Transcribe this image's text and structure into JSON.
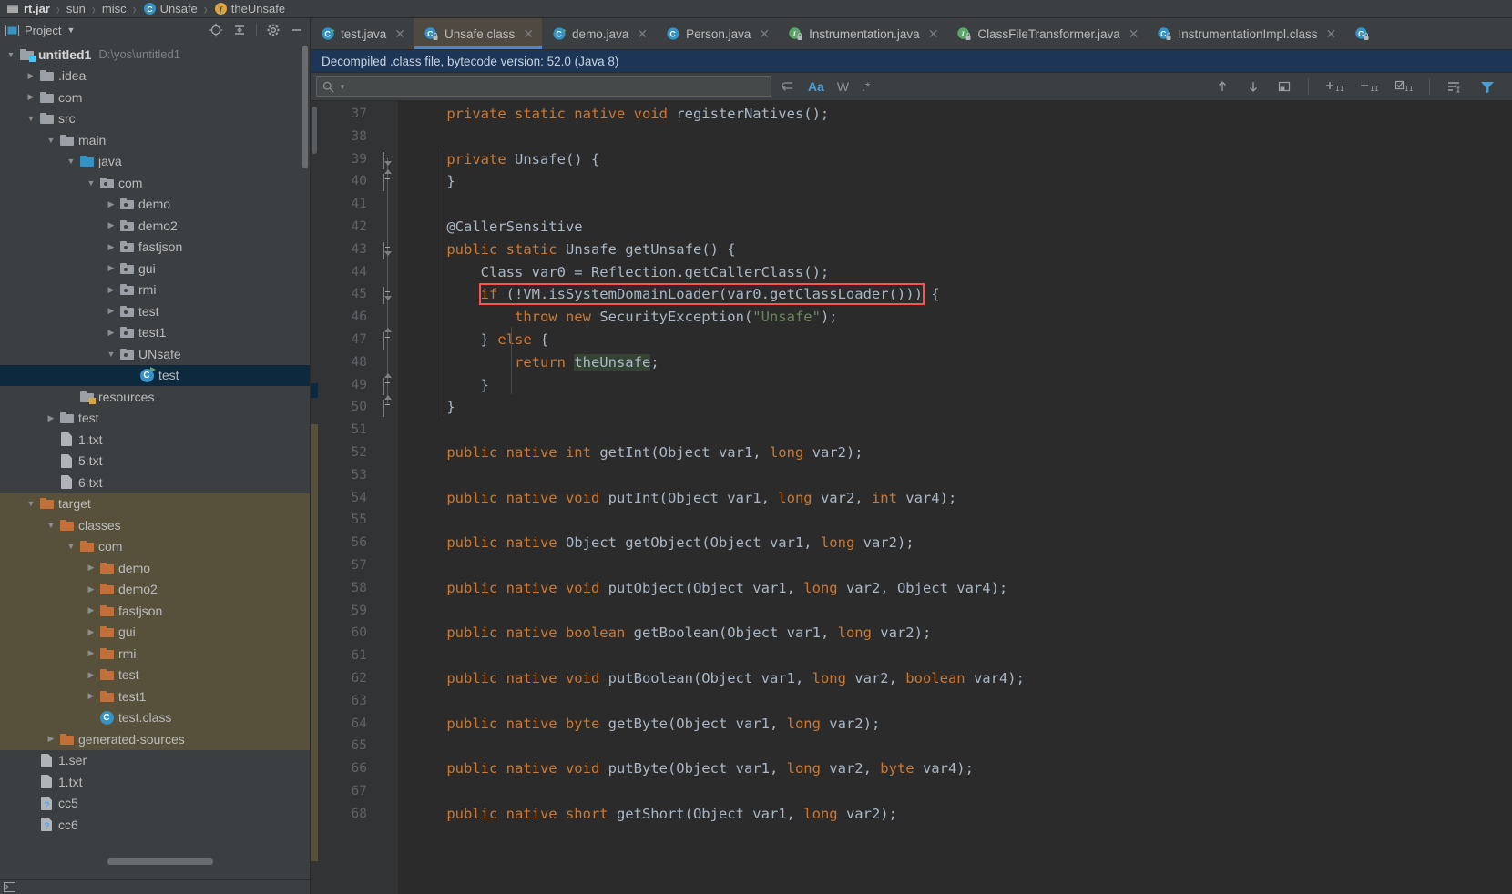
{
  "breadcrumb": [
    {
      "label": "rt.jar",
      "icon": "jar-icon",
      "bold": true
    },
    {
      "label": "sun",
      "icon": "",
      "bold": false
    },
    {
      "label": "misc",
      "icon": "",
      "bold": false
    },
    {
      "label": "Unsafe",
      "icon": "class-icon",
      "bold": false
    },
    {
      "label": "theUnsafe",
      "icon": "field-icon",
      "bold": false
    }
  ],
  "project_panel": {
    "title": "Project",
    "dropdown_glyph": "▼",
    "actions": [
      {
        "name": "locate-icon",
        "glyph": "⊕"
      },
      {
        "name": "collapse-all-icon",
        "glyph": "⌶"
      },
      {
        "name": "settings-gear-icon",
        "glyph": "✿"
      },
      {
        "name": "hide-icon",
        "glyph": "—"
      }
    ],
    "tree": [
      {
        "depth": 0,
        "twisty": "▼",
        "icon": "module-folder-icon",
        "label": "untitled1",
        "bold": true,
        "sub": "D:\\yos\\untitled1",
        "state": "normal"
      },
      {
        "depth": 1,
        "twisty": "▶",
        "icon": "folder-icon",
        "label": ".idea",
        "state": "normal"
      },
      {
        "depth": 1,
        "twisty": "▶",
        "icon": "folder-icon",
        "label": "com",
        "state": "normal"
      },
      {
        "depth": 1,
        "twisty": "▼",
        "icon": "folder-icon",
        "label": "src",
        "state": "normal"
      },
      {
        "depth": 2,
        "twisty": "▼",
        "icon": "folder-icon",
        "label": "main",
        "state": "normal"
      },
      {
        "depth": 3,
        "twisty": "▼",
        "icon": "source-folder-icon",
        "label": "java",
        "state": "normal"
      },
      {
        "depth": 4,
        "twisty": "▼",
        "icon": "package-icon",
        "label": "com",
        "state": "normal"
      },
      {
        "depth": 5,
        "twisty": "▶",
        "icon": "package-icon",
        "label": "demo",
        "state": "normal"
      },
      {
        "depth": 5,
        "twisty": "▶",
        "icon": "package-icon",
        "label": "demo2",
        "state": "normal"
      },
      {
        "depth": 5,
        "twisty": "▶",
        "icon": "package-icon",
        "label": "fastjson",
        "state": "normal"
      },
      {
        "depth": 5,
        "twisty": "▶",
        "icon": "package-icon",
        "label": "gui",
        "state": "normal"
      },
      {
        "depth": 5,
        "twisty": "▶",
        "icon": "package-icon",
        "label": "rmi",
        "state": "normal"
      },
      {
        "depth": 5,
        "twisty": "▶",
        "icon": "package-icon",
        "label": "test",
        "state": "normal"
      },
      {
        "depth": 5,
        "twisty": "▶",
        "icon": "package-icon",
        "label": "test1",
        "state": "normal"
      },
      {
        "depth": 5,
        "twisty": "▼",
        "icon": "package-icon",
        "label": "UNsafe",
        "state": "normal"
      },
      {
        "depth": 6,
        "twisty": "",
        "icon": "java-class-icon",
        "label": "test",
        "state": "selected"
      },
      {
        "depth": 3,
        "twisty": "",
        "icon": "resources-folder-icon",
        "label": "resources",
        "state": "normal"
      },
      {
        "depth": 2,
        "twisty": "▶",
        "icon": "folder-icon",
        "label": "test",
        "state": "normal"
      },
      {
        "depth": 2,
        "twisty": "",
        "icon": "text-file-icon",
        "label": "1.txt",
        "state": "normal"
      },
      {
        "depth": 2,
        "twisty": "",
        "icon": "text-file-icon",
        "label": "5.txt",
        "state": "normal"
      },
      {
        "depth": 2,
        "twisty": "",
        "icon": "text-file-icon",
        "label": "6.txt",
        "state": "normal"
      },
      {
        "depth": 1,
        "twisty": "▼",
        "icon": "excluded-folder-icon",
        "label": "target",
        "state": "excluded"
      },
      {
        "depth": 2,
        "twisty": "▼",
        "icon": "excluded-folder-icon",
        "label": "classes",
        "state": "excluded"
      },
      {
        "depth": 3,
        "twisty": "▼",
        "icon": "excluded-folder-icon",
        "label": "com",
        "state": "excluded"
      },
      {
        "depth": 4,
        "twisty": "▶",
        "icon": "excluded-folder-icon",
        "label": "demo",
        "state": "excluded"
      },
      {
        "depth": 4,
        "twisty": "▶",
        "icon": "excluded-folder-icon",
        "label": "demo2",
        "state": "excluded"
      },
      {
        "depth": 4,
        "twisty": "▶",
        "icon": "excluded-folder-icon",
        "label": "fastjson",
        "state": "excluded"
      },
      {
        "depth": 4,
        "twisty": "▶",
        "icon": "excluded-folder-icon",
        "label": "gui",
        "state": "excluded"
      },
      {
        "depth": 4,
        "twisty": "▶",
        "icon": "excluded-folder-icon",
        "label": "rmi",
        "state": "excluded"
      },
      {
        "depth": 4,
        "twisty": "▶",
        "icon": "excluded-folder-icon",
        "label": "test",
        "state": "excluded"
      },
      {
        "depth": 4,
        "twisty": "▶",
        "icon": "excluded-folder-icon",
        "label": "test1",
        "state": "excluded"
      },
      {
        "depth": 4,
        "twisty": "",
        "icon": "class-file-icon",
        "label": "test.class",
        "state": "excluded"
      },
      {
        "depth": 2,
        "twisty": "▶",
        "icon": "excluded-folder-icon",
        "label": "generated-sources",
        "state": "excluded"
      },
      {
        "depth": 1,
        "twisty": "",
        "icon": "text-file-icon",
        "label": "1.ser",
        "state": "normal"
      },
      {
        "depth": 1,
        "twisty": "",
        "icon": "text-file-icon",
        "label": "1.txt",
        "state": "normal"
      },
      {
        "depth": 1,
        "twisty": "",
        "icon": "unknown-file-icon",
        "label": "cc5",
        "state": "normal"
      },
      {
        "depth": 1,
        "twisty": "",
        "icon": "unknown-file-icon",
        "label": "cc6",
        "state": "normal"
      }
    ]
  },
  "tabs": [
    {
      "label": "test.java",
      "icon": "java-class-icon",
      "active": false,
      "closable": true
    },
    {
      "label": "Unsafe.class",
      "icon": "class-locked-icon",
      "active": true,
      "closable": true
    },
    {
      "label": "demo.java",
      "icon": "java-class-icon",
      "active": false,
      "closable": true
    },
    {
      "label": "Person.java",
      "icon": "class-icon",
      "active": false,
      "closable": true
    },
    {
      "label": "Instrumentation.java",
      "icon": "interface-locked-icon",
      "active": false,
      "closable": true
    },
    {
      "label": "ClassFileTransformer.java",
      "icon": "interface-locked-icon",
      "active": false,
      "closable": true
    },
    {
      "label": "InstrumentationImpl.class",
      "icon": "class-locked-icon",
      "active": false,
      "closable": true
    },
    {
      "label": "",
      "icon": "class-locked-icon",
      "active": false,
      "closable": false
    }
  ],
  "notice": {
    "text": "Decompiled .class file, bytecode version: 52.0 (Java 8)",
    "background": "#1d3557"
  },
  "find_bar": {
    "search_placeholder": "",
    "search_value": "",
    "search_icon": "magnifier-icon",
    "wrap_icon": "wrap-icon",
    "options": [
      {
        "name": "match-case-toggle",
        "glyph": "Aa",
        "active": true
      },
      {
        "name": "whole-words-toggle",
        "glyph": "W",
        "active": false
      },
      {
        "name": "regex-toggle",
        "glyph": ".*",
        "active": false
      }
    ],
    "right_tools": [
      {
        "name": "prev-occurrence-icon",
        "glyph": "↑"
      },
      {
        "name": "next-occurrence-icon",
        "glyph": "↓"
      },
      {
        "name": "open-in-find-window-icon",
        "glyph": "▢"
      },
      {
        "name": "expand-all-icon",
        "glyph": "+"
      },
      {
        "name": "collapse-all-icon",
        "glyph": "−"
      },
      {
        "name": "select-all-occurrences-icon",
        "glyph": "☑"
      },
      {
        "name": "sort-icon",
        "glyph": "≡"
      },
      {
        "name": "filter-icon",
        "glyph": "▼"
      }
    ]
  },
  "editor": {
    "first_line": 37,
    "language": "java",
    "highlighted_identifier": "theUnsafe",
    "boxed_line": 45,
    "lines": [
      {
        "n": 37,
        "fold": "",
        "tokens": [
          {
            "t": "    ",
            "c": "plain"
          },
          {
            "t": "private static native void ",
            "c": "kw"
          },
          {
            "t": "registerNatives();",
            "c": "plain"
          }
        ]
      },
      {
        "n": 38,
        "fold": "",
        "tokens": []
      },
      {
        "n": 39,
        "fold": "down",
        "tokens": [
          {
            "t": "    ",
            "c": "plain"
          },
          {
            "t": "private ",
            "c": "kw"
          },
          {
            "t": "Unsafe() {",
            "c": "plain"
          }
        ]
      },
      {
        "n": 40,
        "fold": "up",
        "tokens": [
          {
            "t": "    }",
            "c": "plain"
          }
        ]
      },
      {
        "n": 41,
        "fold": "",
        "tokens": []
      },
      {
        "n": 42,
        "fold": "",
        "tokens": [
          {
            "t": "    ",
            "c": "plain"
          },
          {
            "t": "@CallerSensitive",
            "c": "plain"
          }
        ]
      },
      {
        "n": 43,
        "fold": "down",
        "tokens": [
          {
            "t": "    ",
            "c": "plain"
          },
          {
            "t": "public static ",
            "c": "kw"
          },
          {
            "t": "Unsafe getUnsafe() {",
            "c": "plain"
          }
        ]
      },
      {
        "n": 44,
        "fold": "",
        "tokens": [
          {
            "t": "        Class var0 = Reflection.getCallerClass();",
            "c": "plain"
          }
        ]
      },
      {
        "n": 45,
        "fold": "down",
        "tokens": [
          {
            "t": "        ",
            "c": "plain"
          },
          {
            "t": "if",
            "c": "kw",
            "box": "start"
          },
          {
            "t": " (!VM.isSystemDomainLoader(var0.getClassLoader()))",
            "c": "plain",
            "box": "end"
          },
          {
            "t": " {",
            "c": "plain"
          }
        ]
      },
      {
        "n": 46,
        "fold": "",
        "tokens": [
          {
            "t": "            ",
            "c": "plain"
          },
          {
            "t": "throw new ",
            "c": "kw"
          },
          {
            "t": "SecurityException(",
            "c": "plain"
          },
          {
            "t": "\"Unsafe\"",
            "c": "str"
          },
          {
            "t": ");",
            "c": "plain"
          }
        ]
      },
      {
        "n": 47,
        "fold": "up",
        "tokens": [
          {
            "t": "        } ",
            "c": "plain"
          },
          {
            "t": "else",
            "c": "kw"
          },
          {
            "t": " {",
            "c": "plain"
          }
        ]
      },
      {
        "n": 48,
        "fold": "",
        "tokens": [
          {
            "t": "            ",
            "c": "plain"
          },
          {
            "t": "return ",
            "c": "kw"
          },
          {
            "t": "theUnsafe",
            "c": "plain",
            "hl": "green"
          },
          {
            "t": ";",
            "c": "plain"
          }
        ]
      },
      {
        "n": 49,
        "fold": "up",
        "tokens": [
          {
            "t": "        }",
            "c": "plain"
          }
        ]
      },
      {
        "n": 50,
        "fold": "up",
        "tokens": [
          {
            "t": "    }",
            "c": "plain"
          }
        ]
      },
      {
        "n": 51,
        "fold": "",
        "tokens": []
      },
      {
        "n": 52,
        "fold": "",
        "tokens": [
          {
            "t": "    ",
            "c": "plain"
          },
          {
            "t": "public native int ",
            "c": "kw"
          },
          {
            "t": "getInt(Object var1, ",
            "c": "plain"
          },
          {
            "t": "long ",
            "c": "kw"
          },
          {
            "t": "var2);",
            "c": "plain"
          }
        ]
      },
      {
        "n": 53,
        "fold": "",
        "tokens": []
      },
      {
        "n": 54,
        "fold": "",
        "tokens": [
          {
            "t": "    ",
            "c": "plain"
          },
          {
            "t": "public native void ",
            "c": "kw"
          },
          {
            "t": "putInt(Object var1, ",
            "c": "plain"
          },
          {
            "t": "long ",
            "c": "kw"
          },
          {
            "t": "var2, ",
            "c": "plain"
          },
          {
            "t": "int ",
            "c": "kw"
          },
          {
            "t": "var4);",
            "c": "plain"
          }
        ]
      },
      {
        "n": 55,
        "fold": "",
        "tokens": []
      },
      {
        "n": 56,
        "fold": "",
        "tokens": [
          {
            "t": "    ",
            "c": "plain"
          },
          {
            "t": "public native ",
            "c": "kw"
          },
          {
            "t": "Object getObject(Object var1, ",
            "c": "plain"
          },
          {
            "t": "long ",
            "c": "kw"
          },
          {
            "t": "var2);",
            "c": "plain"
          }
        ]
      },
      {
        "n": 57,
        "fold": "",
        "tokens": []
      },
      {
        "n": 58,
        "fold": "",
        "tokens": [
          {
            "t": "    ",
            "c": "plain"
          },
          {
            "t": "public native void ",
            "c": "kw"
          },
          {
            "t": "putObject(Object var1, ",
            "c": "plain"
          },
          {
            "t": "long ",
            "c": "kw"
          },
          {
            "t": "var2, Object var4);",
            "c": "plain"
          }
        ]
      },
      {
        "n": 59,
        "fold": "",
        "tokens": []
      },
      {
        "n": 60,
        "fold": "",
        "tokens": [
          {
            "t": "    ",
            "c": "plain"
          },
          {
            "t": "public native boolean ",
            "c": "kw"
          },
          {
            "t": "getBoolean(Object var1, ",
            "c": "plain"
          },
          {
            "t": "long ",
            "c": "kw"
          },
          {
            "t": "var2);",
            "c": "plain"
          }
        ]
      },
      {
        "n": 61,
        "fold": "",
        "tokens": []
      },
      {
        "n": 62,
        "fold": "",
        "tokens": [
          {
            "t": "    ",
            "c": "plain"
          },
          {
            "t": "public native void ",
            "c": "kw"
          },
          {
            "t": "putBoolean(Object var1, ",
            "c": "plain"
          },
          {
            "t": "long ",
            "c": "kw"
          },
          {
            "t": "var2, ",
            "c": "plain"
          },
          {
            "t": "boolean ",
            "c": "kw"
          },
          {
            "t": "var4);",
            "c": "plain"
          }
        ]
      },
      {
        "n": 63,
        "fold": "",
        "tokens": []
      },
      {
        "n": 64,
        "fold": "",
        "tokens": [
          {
            "t": "    ",
            "c": "plain"
          },
          {
            "t": "public native byte ",
            "c": "kw"
          },
          {
            "t": "getByte(Object var1, ",
            "c": "plain"
          },
          {
            "t": "long ",
            "c": "kw"
          },
          {
            "t": "var2);",
            "c": "plain"
          }
        ]
      },
      {
        "n": 65,
        "fold": "",
        "tokens": []
      },
      {
        "n": 66,
        "fold": "",
        "tokens": [
          {
            "t": "    ",
            "c": "plain"
          },
          {
            "t": "public native void ",
            "c": "kw"
          },
          {
            "t": "putByte(Object var1, ",
            "c": "plain"
          },
          {
            "t": "long ",
            "c": "kw"
          },
          {
            "t": "var2, ",
            "c": "plain"
          },
          {
            "t": "byte ",
            "c": "kw"
          },
          {
            "t": "var4);",
            "c": "plain"
          }
        ]
      },
      {
        "n": 67,
        "fold": "",
        "tokens": []
      },
      {
        "n": 68,
        "fold": "",
        "tokens": [
          {
            "t": "    ",
            "c": "plain"
          },
          {
            "t": "public native short ",
            "c": "kw"
          },
          {
            "t": "getShort(Object var1, ",
            "c": "plain"
          },
          {
            "t": "long ",
            "c": "kw"
          },
          {
            "t": "var2);",
            "c": "plain"
          }
        ]
      }
    ]
  },
  "colors": {
    "keyword": "#cc7832",
    "string": "#6a8759",
    "plain": "#a9b7c6",
    "editor_bg": "#2b2b2b",
    "panel_bg": "#3c3f41",
    "gutter_bg": "#313335",
    "selection": "#0d293e",
    "excluded_row": "#57513c",
    "active_tab": "#4e4a41",
    "tab_underline": "#4a88c7",
    "notice_bg": "#1d3557",
    "box_outline": "#ff5252",
    "identifier_highlight": "#344334"
  }
}
